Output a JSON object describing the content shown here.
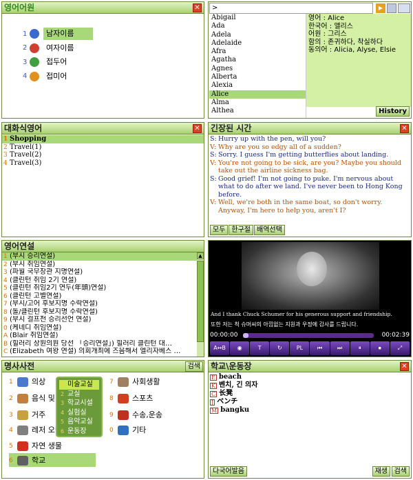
{
  "etymology": {
    "title": "영어어원",
    "items": [
      {
        "num": "1",
        "label": "남자이름"
      },
      {
        "num": "2",
        "label": "여자이름"
      },
      {
        "num": "3",
        "label": "접두어"
      },
      {
        "num": "4",
        "label": "접미어"
      }
    ]
  },
  "names": {
    "search": ">",
    "names": [
      "Abigail",
      "Ada",
      "Adela",
      "Adelaide",
      "Afra",
      "Agatha",
      "Agnes",
      "Alberta",
      "Alexia",
      "Alice",
      "Alma",
      "Althea"
    ],
    "detail": [
      "영어 : Alice",
      "한국어 : 앨리스",
      "어원 : 그리스",
      "함의 : 존귀하다, 착실하다",
      "동의어 : Alicia, Alyse, Elsie"
    ],
    "history": "History"
  },
  "conversation": {
    "title": "대화식영어",
    "items": [
      {
        "num": "1",
        "label": "Shopping"
      },
      {
        "num": "2",
        "label": "Travel(1)"
      },
      {
        "num": "3",
        "label": "Travel(2)"
      },
      {
        "num": "4",
        "label": "Travel(3)"
      }
    ]
  },
  "tense": {
    "title": "긴장된 시간",
    "lines": [
      {
        "s": "S:",
        "t": "Hurry up with the pen, will you?"
      },
      {
        "s": "V:",
        "t": "Why are you so edgy all of a sudden?"
      },
      {
        "s": "S:",
        "t": "Sorry. I guess I'm getting butterflies about landing."
      },
      {
        "s": "V:",
        "t": "You're not going to be sick, are you? Maybe you should take out the airline sickness bag."
      },
      {
        "s": "S:",
        "t": "Good grief! I'm not going to puke. I'm nervous about what to do after we land. I've never been to Hong Kong before."
      },
      {
        "s": "V:",
        "t": "Well, we're both in the same boat, so don't worry. Anyway, I'm here to help you, aren't I?"
      }
    ],
    "buttons": [
      "모두",
      "한구절",
      "배역선택"
    ]
  },
  "speeches": {
    "title": "영어연설",
    "items": [
      {
        "num": "1",
        "label": "(부시 승리연설)"
      },
      {
        "num": "2",
        "label": "(부시 취임연설)"
      },
      {
        "num": "3",
        "label": "(파월 국무장관 지명연설)"
      },
      {
        "num": "4",
        "label": "(클린턴 취임 2기 연설)"
      },
      {
        "num": "5",
        "label": "(클린턴 취임2기 연두(年頭)연설)"
      },
      {
        "num": "6",
        "label": "(클린턴 고별연설)"
      },
      {
        "num": "7",
        "label": "(부시/고어 후보지명 수락연설)"
      },
      {
        "num": "8",
        "label": "(돌/클린턴 후보지명 수락연설)"
      },
      {
        "num": "9",
        "label": "(부시 걸프전 승리선언 연설)"
      },
      {
        "num": "0",
        "label": "(케네디 취임연설)"
      },
      {
        "num": "A",
        "label": "(Blair 취임연설)"
      },
      {
        "num": "B",
        "label": "(힐러리 상원의원 당선 「승리연설」) 힐러리 클린턴 대…"
      },
      {
        "num": "C",
        "label": "(Elizabeth 여왕 연설) 의회개최에 즈음해서 엘리자베스 …"
      }
    ]
  },
  "video": {
    "caption_en": "And I thank Chuck Schumer for his generous support and friendship.",
    "caption_ko": "또한 저는 척 슈머씨의 아낌없는 지원과 우정에 감사를 드립니다.",
    "time_start": "00:00:00",
    "time_end": "00:02:39",
    "progress": 0.04,
    "controls": [
      "A↔B",
      "◉",
      "T",
      "↻",
      "PL",
      "⏮",
      "⏭",
      "⏸",
      "⏹",
      "⤢"
    ]
  },
  "dictionary": {
    "title": "명사사전",
    "search": "검색",
    "categories": [
      {
        "num": "1",
        "label": "의상",
        "icon": "person-icon",
        "color": "#4a7ad0"
      },
      {
        "num": "2",
        "label": "음식 및",
        "icon": "food-icon",
        "color": "#c08040"
      },
      {
        "num": "3",
        "label": "거주",
        "icon": "house-icon",
        "color": "#c8a040"
      },
      {
        "num": "4",
        "label": "레저 오락",
        "icon": "leisure-icon",
        "color": "#808080"
      },
      {
        "num": "5",
        "label": "자연 생물",
        "icon": "ladybug-icon",
        "color": "#d03020"
      },
      {
        "num": "6",
        "label": "학교",
        "icon": "school-icon",
        "color": "#606060"
      },
      {
        "num": "7",
        "label": "사회생활",
        "icon": "cup-icon",
        "color": "#a08060"
      },
      {
        "num": "8",
        "label": "스포츠",
        "icon": "sport-icon",
        "color": "#d04020"
      },
      {
        "num": "9",
        "label": "수송,운송",
        "icon": "truck-icon",
        "color": "#c03020"
      },
      {
        "num": "0",
        "label": "기타",
        "icon": "arrow-icon",
        "color": "#3070c0"
      }
    ],
    "submenu": [
      {
        "num": "1",
        "label": "미술교실"
      },
      {
        "num": "2",
        "label": "교실"
      },
      {
        "num": "3",
        "label": "학교시설"
      },
      {
        "num": "4",
        "label": "실험실"
      },
      {
        "num": "5",
        "label": "음악교실"
      },
      {
        "num": "6",
        "label": "운동장"
      }
    ]
  },
  "playground": {
    "title": "학교\\운동장",
    "words": [
      {
        "tag": "E",
        "text": "beach"
      },
      {
        "tag": "K",
        "text": "벤치, 긴 의자"
      },
      {
        "tag": "C",
        "text": "长凳"
      },
      {
        "tag": "J",
        "text": "ベンチ"
      },
      {
        "tag": "M",
        "text": "bangku"
      }
    ],
    "btn_multi": "다국어발음",
    "btn_play": "재생",
    "btn_search": "검색"
  }
}
